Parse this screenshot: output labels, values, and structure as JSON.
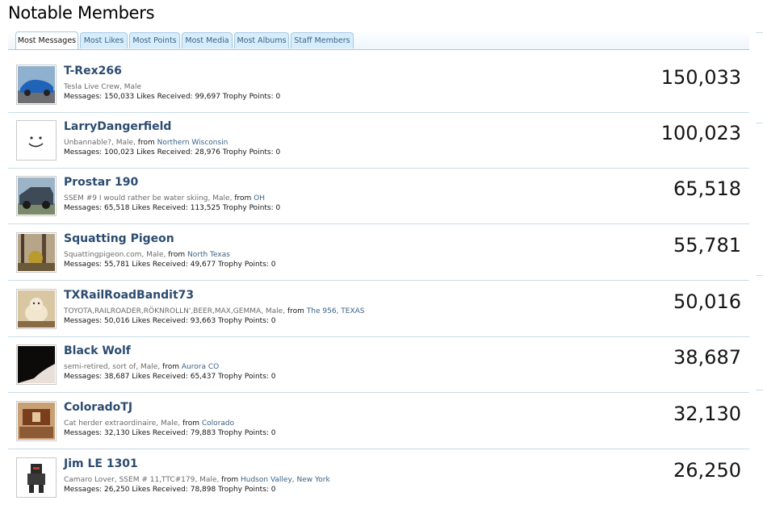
{
  "page": {
    "title": "Notable Members"
  },
  "tabs": [
    {
      "label": "Most Messages",
      "active": true
    },
    {
      "label": "Most Likes",
      "active": false
    },
    {
      "label": "Most Points",
      "active": false
    },
    {
      "label": "Most Media",
      "active": false
    },
    {
      "label": "Most Albums",
      "active": false
    },
    {
      "label": "Staff Members",
      "active": false
    }
  ],
  "members": [
    {
      "name": "T-Rex266",
      "title": "Tesla Live Crew",
      "gender": "Male",
      "from_label": "",
      "location": "",
      "stats": "Messages: 150,033 Likes Received: 99,697 Trophy Points: 0",
      "count": "150,033",
      "avatar_icon": "car-photo-icon"
    },
    {
      "name": "LarryDangerfield",
      "title": "Unbannable?",
      "gender": "Male",
      "from_label": "from",
      "location": "Northern Wisconsin",
      "stats": "Messages: 100,023 Likes Received: 28,976 Trophy Points: 0",
      "count": "100,023",
      "avatar_icon": "smiley-face-icon"
    },
    {
      "name": "Prostar 190",
      "title": "SSEM #9 I would rather be water skiing",
      "gender": "Male",
      "from_label": "from",
      "location": "OH",
      "stats": "Messages: 65,518 Likes Received: 113,525 Trophy Points: 0",
      "count": "65,518",
      "avatar_icon": "truck-photo-icon"
    },
    {
      "name": "Squatting Pigeon",
      "title": "Squattingpigeon.com",
      "gender": "Male",
      "from_label": "from",
      "location": "North Texas",
      "stats": "Messages: 55,781 Likes Received: 49,677 Trophy Points: 0",
      "count": "55,781",
      "avatar_icon": "forest-photo-icon"
    },
    {
      "name": "TXRailRoadBandit73",
      "title": "TOYOTA,RAILROADER,RÖKNROLLN',BEER,MAX,GEMMA",
      "gender": "Male",
      "from_label": "from",
      "location": "The 956, TEXAS",
      "stats": "Messages: 50,016 Likes Received: 93,663 Trophy Points: 0",
      "count": "50,016",
      "avatar_icon": "dog-photo-icon"
    },
    {
      "name": "Black Wolf",
      "title": "semi-retired, sort of",
      "gender": "Male",
      "from_label": "from",
      "location": "Aurora CO",
      "stats": "Messages: 38,687 Likes Received: 65,437 Trophy Points: 0",
      "count": "38,687",
      "avatar_icon": "dark-photo-icon"
    },
    {
      "name": "ColoradoTJ",
      "title": "Cat herder extraordinaire",
      "gender": "Male",
      "from_label": "from",
      "location": "Colorado",
      "stats": "Messages: 32,130 Likes Received: 79,883 Trophy Points: 0",
      "count": "32,130",
      "avatar_icon": "interior-photo-icon"
    },
    {
      "name": "Jim LE 1301",
      "title": "Camaro Lover, SSEM # 11,TTC#179",
      "gender": "Male",
      "from_label": "from",
      "location": "Hudson Valley, New York",
      "stats": "Messages: 26,250 Likes Received: 78,898 Trophy Points: 0",
      "count": "26,250",
      "avatar_icon": "robot-photo-icon"
    }
  ]
}
